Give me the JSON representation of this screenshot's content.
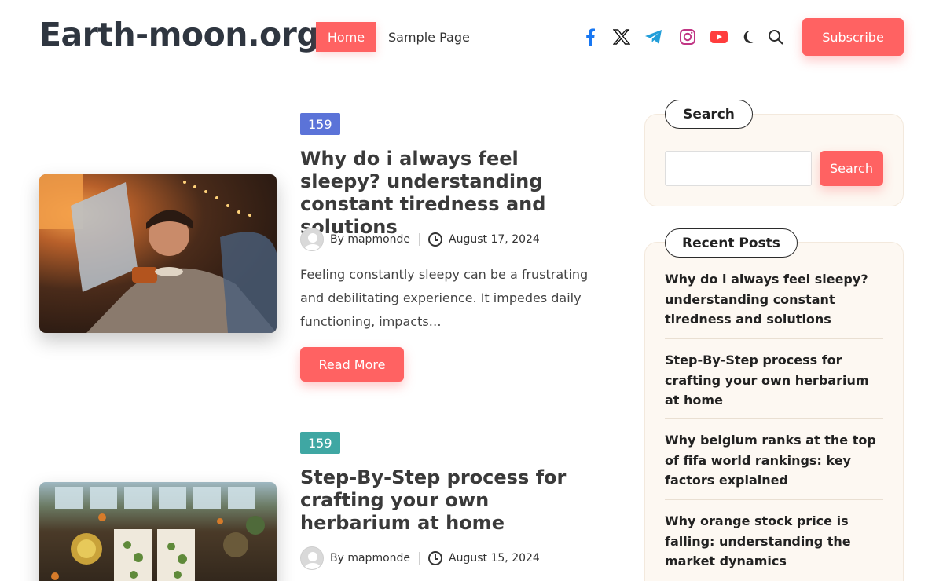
{
  "header": {
    "logo": "Earth-moon.org",
    "nav": {
      "home": "Home",
      "sample": "Sample Page"
    },
    "icons": [
      "facebook-icon",
      "x-icon",
      "telegram-icon",
      "instagram-icon",
      "youtube-icon",
      "dark-mode-moon-icon",
      "search-icon"
    ],
    "subscribe": "Subscribe"
  },
  "colors": {
    "accent": "#ff6262",
    "tag1": "#5b73d8",
    "tag2": "#3fa7a3",
    "facebook": "#1877f2",
    "telegram": "#229ed9",
    "instagram": "#c13584",
    "youtube": "#ff3d3d"
  },
  "posts": [
    {
      "tag": "159",
      "title": "Why do i always feel sleepy? understanding constant tiredness and solutions",
      "author": "By mapmonde",
      "date": "August 17, 2024",
      "excerpt": "Feeling constantly sleepy can be a frustrating and debilitating experience. It impedes daily functioning, impacts…",
      "read_more": "Read More"
    },
    {
      "tag": "159",
      "title": "Step-By-Step process for crafting your own herbarium at home",
      "author": "By mapmonde",
      "date": "August 15, 2024"
    }
  ],
  "sidebar": {
    "search": {
      "title": "Search",
      "button": "Search",
      "placeholder": ""
    },
    "recent": {
      "title": "Recent Posts",
      "items": [
        "Why do i always feel sleepy? understanding constant tiredness and solutions",
        "Step-By-Step process for crafting your own herbarium at home",
        "Why belgium ranks at the top of fifa world rankings: key factors explained",
        "Why orange stock price is falling: understanding the market dynamics"
      ]
    }
  }
}
